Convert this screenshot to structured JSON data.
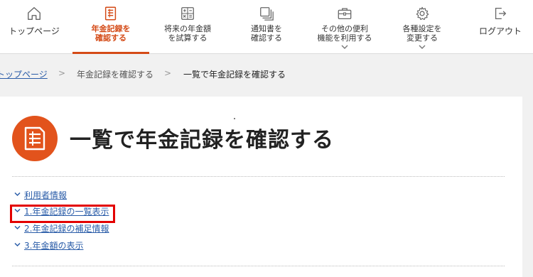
{
  "nav": {
    "items": [
      {
        "label": "トップページ",
        "icon": "home-icon"
      },
      {
        "label": "年金記録を\n確認する",
        "icon": "document-list-icon",
        "active": true
      },
      {
        "label": "将来の年金額\nを試算する",
        "icon": "calculator-icon"
      },
      {
        "label": "通知書を\n確認する",
        "icon": "notices-icon"
      },
      {
        "label": "その他の便利\n機能を利用する",
        "icon": "toolbox-icon"
      },
      {
        "label": "各種設定を\n変更する",
        "icon": "gear-icon"
      },
      {
        "label": "ログアウト",
        "icon": "logout-icon"
      }
    ],
    "accent_color": "#d44a16"
  },
  "breadcrumb": {
    "items": [
      "トップページ",
      "年金記録を確認する",
      "一覧で年金記録を確認する"
    ],
    "separator": ">"
  },
  "page": {
    "title": "一覧で年金記録を確認する",
    "icon": "document-list-icon",
    "icon_color": "#e2531c"
  },
  "toc": {
    "items": [
      "利用者情報",
      "1.年金記録の一覧表示",
      "2.年金記録の補足情報",
      "3.年金額の表示"
    ],
    "highlight_color": "#e30000",
    "link_color": "#2a5ca8"
  }
}
